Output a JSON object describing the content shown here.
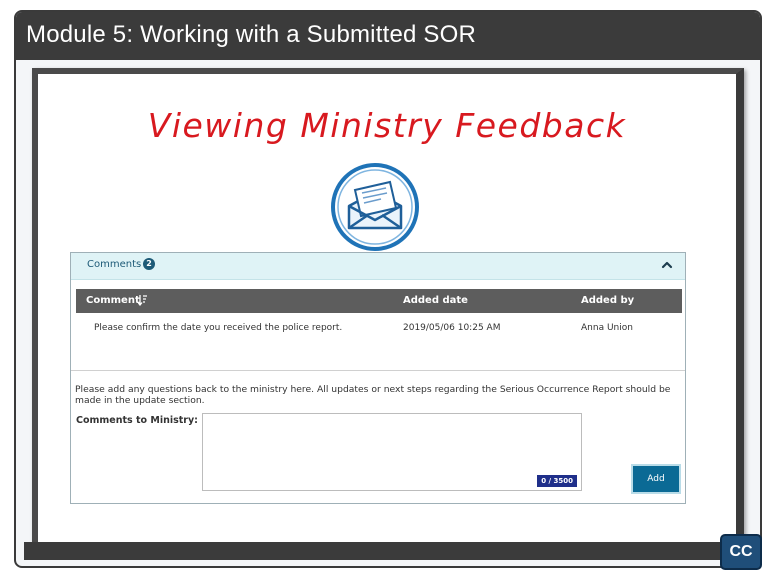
{
  "slide": {
    "title": "Module 5:  Working with a Submitted SOR",
    "heading": "Viewing Ministry Feedback",
    "cc_label": "CC"
  },
  "colors": {
    "title_bar": "#3b3b3b",
    "heading": "#d8191f",
    "panel_header_bg": "#dff3f6",
    "table_header_bg": "#5d5d5d",
    "add_button": "#0b6a95",
    "counter_bg": "#1f2f8a",
    "cc_button": "#1f4e79"
  },
  "icons": {
    "envelope": "open-envelope-icon",
    "collapse": "chevron-up-icon",
    "sort": "sort-descending-icon"
  },
  "comments": {
    "title": "Comments",
    "count": "2",
    "columns": {
      "comment": "Comment",
      "added_date": "Added date",
      "added_by": "Added by"
    },
    "rows": [
      {
        "comment": "Please confirm the date you received the police report.",
        "added_date": "2019/05/06 10:25 AM",
        "added_by": "Anna Union"
      }
    ],
    "instructions": "Please add any questions back to the ministry here. All updates or next steps regarding the Serious Occurrence Report should be made in the update section.",
    "field_label": "Comments to Ministry:",
    "field_value": "",
    "char_counter": "0 / 3500",
    "add_label": "Add"
  }
}
